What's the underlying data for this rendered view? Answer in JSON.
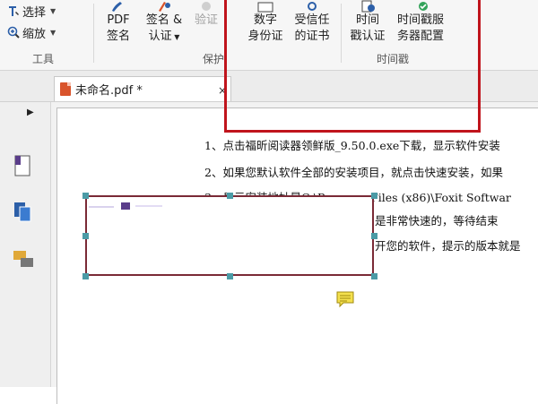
{
  "toolbar": {
    "select_label": "选择",
    "zoom_label": "缩放",
    "tools_group": "工具",
    "pdf_sign_label_1": "PDF",
    "pdf_sign_label_2": "签名",
    "sign_cert_label_1": "签名 &",
    "sign_cert_label_2": "认证",
    "verify_label": "验证",
    "protect_group": "保护",
    "digital_id_label_1": "数字",
    "digital_id_label_2": "身份证",
    "trusted_cert_label_1": "受信任",
    "trusted_cert_label_2": "的证书",
    "timestamp_verify_label_1": "时间",
    "timestamp_verify_label_2": "戳认证",
    "timestamp_server_label_1": "时间戳服",
    "timestamp_server_label_2": "务器配置",
    "timestamp_group": "时间戳"
  },
  "tab": {
    "title": "未命名.pdf *",
    "close": "×"
  },
  "document": {
    "lines": [
      "1、点击福昕阅读器领鲜版_9.50.0.exe下载，显示软件安装",
      "2、如果您默认软件全部的安装项目，就点击快速安装，如果",
      "3、显示安装地址是C:\\Program Files (x86)\\Foxit Softwar",
      "是非常快速的，等待结束",
      "开您的软件，提示的版本就是"
    ]
  },
  "colors": {
    "red_highlight": "#c0141c",
    "selection_border": "#7a2a36",
    "handle": "#4b9ba6"
  }
}
